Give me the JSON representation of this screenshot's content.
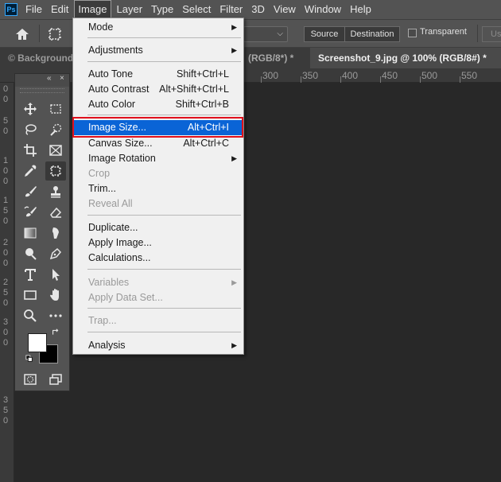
{
  "app": {
    "logo": "Ps"
  },
  "menubar": {
    "items": [
      "File",
      "Edit",
      "Image",
      "Layer",
      "Type",
      "Select",
      "Filter",
      "3D",
      "View",
      "Window",
      "Help"
    ],
    "active": "Image"
  },
  "options": {
    "source": "Source",
    "destination": "Destination",
    "transparent": "Transparent",
    "use": "Us"
  },
  "tabs": {
    "background": "© Background",
    "middle": "(RGB/8*) *",
    "active": "Screenshot_9.jpg @ 100% (RGB/8#) *"
  },
  "ruler": {
    "top_labels": [
      "300",
      "350",
      "400",
      "450",
      "500",
      "550"
    ],
    "left_digits": [
      "0",
      "0",
      "5",
      "0",
      "1",
      "0",
      "0",
      "1",
      "5",
      "0",
      "2",
      "0",
      "0",
      "2",
      "5",
      "0",
      "3",
      "0",
      "0",
      "3",
      "5",
      "0"
    ]
  },
  "toolbar": {
    "collapse": "«",
    "close": "×",
    "tools": [
      "move-icon",
      "marquee-icon",
      "lasso-icon",
      "quick-select-icon",
      "crop-icon",
      "frame-icon",
      "eyedropper-icon",
      "patch-icon",
      "brush-icon",
      "stamp-icon",
      "history-brush-icon",
      "eraser-icon",
      "gradient-icon",
      "smudge-icon",
      "dodge-icon",
      "pen-icon",
      "type-icon",
      "path-select-icon",
      "rectangle-icon",
      "hand-icon",
      "zoom-icon",
      "more-icon",
      "quick-mask-icon",
      "screen-mode-icon"
    ]
  },
  "image_menu": {
    "mode": "Mode",
    "adjustments": "Adjustments",
    "auto_tone": "Auto Tone",
    "auto_tone_sc": "Shift+Ctrl+L",
    "auto_contrast": "Auto Contrast",
    "auto_contrast_sc": "Alt+Shift+Ctrl+L",
    "auto_color": "Auto Color",
    "auto_color_sc": "Shift+Ctrl+B",
    "image_size": "Image Size...",
    "image_size_sc": "Alt+Ctrl+I",
    "canvas_size": "Canvas Size...",
    "canvas_size_sc": "Alt+Ctrl+C",
    "image_rotation": "Image Rotation",
    "crop": "Crop",
    "trim": "Trim...",
    "reveal_all": "Reveal All",
    "duplicate": "Duplicate...",
    "apply_image": "Apply Image...",
    "calculations": "Calculations...",
    "variables": "Variables",
    "apply_data_set": "Apply Data Set...",
    "trap": "Trap...",
    "analysis": "Analysis"
  },
  "colors": {
    "highlight": "#0a64d6",
    "annotation_box": "#e0101c",
    "foreground": "#ffffff",
    "background": "#000000"
  }
}
